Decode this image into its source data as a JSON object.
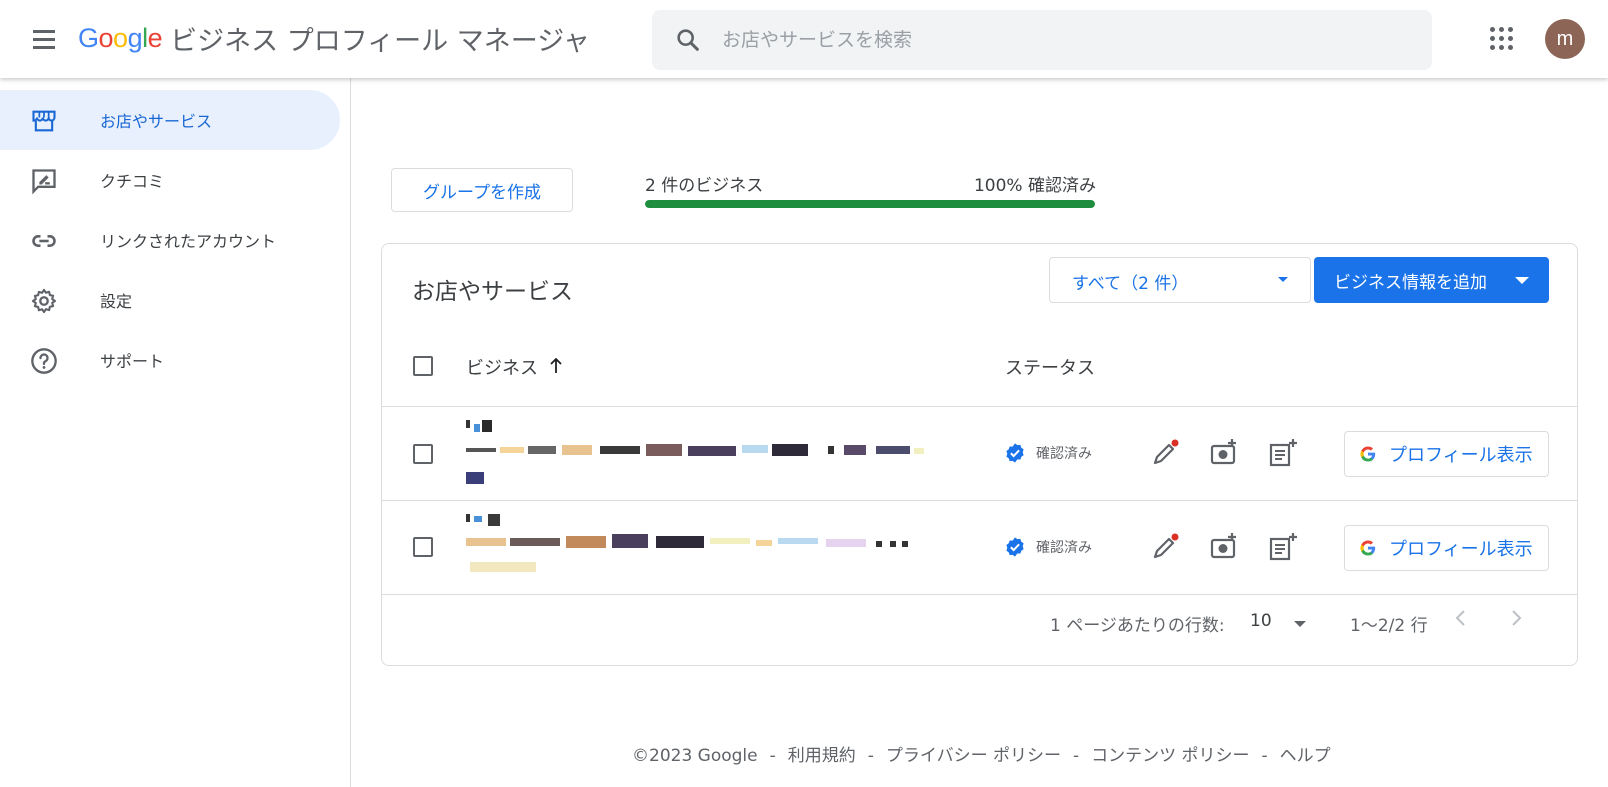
{
  "header": {
    "logo_google": "Google",
    "product_name": "ビジネス プロフィール マネージャ",
    "search_placeholder": "お店やサービスを検索",
    "avatar_initial": "m"
  },
  "sidebar": {
    "items": [
      {
        "label": "お店やサービス",
        "icon": "store-icon",
        "active": true
      },
      {
        "label": "クチコミ",
        "icon": "reviews-icon",
        "active": false
      },
      {
        "label": "リンクされたアカウント",
        "icon": "link-icon",
        "active": false
      },
      {
        "label": "設定",
        "icon": "gear-icon",
        "active": false
      },
      {
        "label": "サポート",
        "icon": "help-icon",
        "active": false
      }
    ]
  },
  "main": {
    "create_group_label": "グループを作成",
    "business_count_text": "2 件のビジネス",
    "verified_text": "100% 確認済み",
    "verified_fraction": 1.0,
    "card": {
      "title": "お店やサービス",
      "filter_label": "すべて（2 件）",
      "add_button_label": "ビジネス情報を追加",
      "col_business": "ビジネス",
      "col_status": "ステータス",
      "rows": [
        {
          "status": "確認済み",
          "profile_label": "プロフィール表示"
        },
        {
          "status": "確認済み",
          "profile_label": "プロフィール表示"
        }
      ],
      "pager": {
        "rows_per_page_label": "1 ページあたりの行数:",
        "rows_per_page_value": "10",
        "range_text": "1〜2/2 行"
      }
    }
  },
  "footer": {
    "copyright": "©2023 Google",
    "terms": "利用規約",
    "privacy": "プライバシー ポリシー",
    "content_policy": "コンテンツ ポリシー",
    "help": "ヘルプ",
    "separator": "-"
  },
  "colors": {
    "accent": "#1a73e8",
    "progress": "#1e8e3e",
    "active_nav_bg": "#e8f0fe",
    "avatar_bg": "#8d6557",
    "notification_dot": "#d93025"
  }
}
